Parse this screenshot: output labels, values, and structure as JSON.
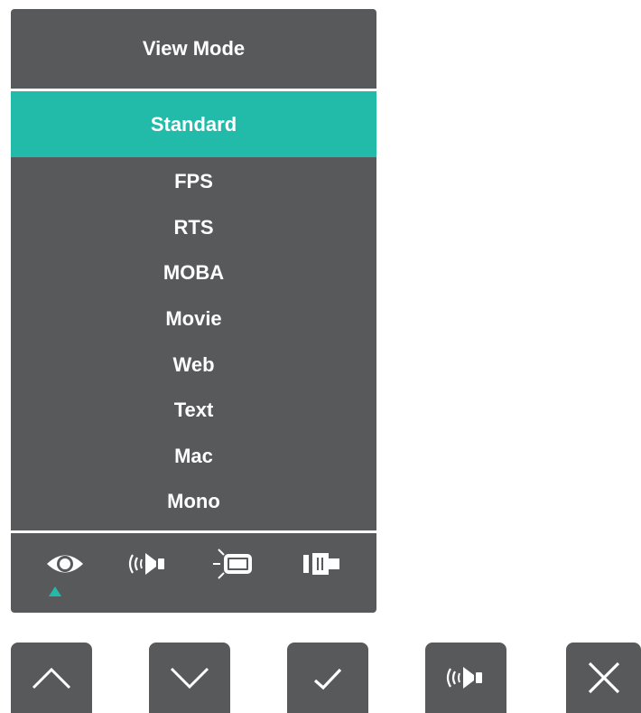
{
  "osd": {
    "title": "View Mode",
    "items": [
      {
        "label": "Standard",
        "selected": true
      },
      {
        "label": "FPS",
        "selected": false
      },
      {
        "label": "RTS",
        "selected": false
      },
      {
        "label": "MOBA",
        "selected": false
      },
      {
        "label": "Movie",
        "selected": false
      },
      {
        "label": "Web",
        "selected": false
      },
      {
        "label": "Text",
        "selected": false
      },
      {
        "label": "Mac",
        "selected": false
      },
      {
        "label": "Mono",
        "selected": false
      }
    ],
    "tabs": [
      {
        "icon": "eye-icon",
        "active": true
      },
      {
        "icon": "audio-icon",
        "active": false
      },
      {
        "icon": "display-brightness-icon",
        "active": false
      },
      {
        "icon": "input-connector-icon",
        "active": false
      }
    ]
  },
  "keys": [
    {
      "icon": "chevron-up-icon"
    },
    {
      "icon": "chevron-down-icon"
    },
    {
      "icon": "checkmark-icon"
    },
    {
      "icon": "audio-icon"
    },
    {
      "icon": "close-icon"
    }
  ],
  "colors": {
    "panel": "#58595b",
    "accent": "#22bbaa",
    "text": "#ffffff"
  }
}
